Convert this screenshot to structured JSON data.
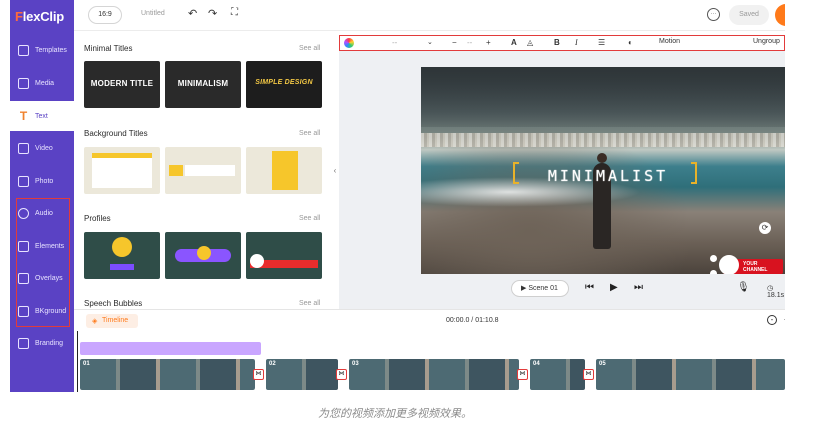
{
  "app": {
    "logo_f": "F",
    "logo_rest": "lexClip"
  },
  "sidebar": {
    "items": [
      {
        "label": "Templates",
        "icon": "layers-icon"
      },
      {
        "label": "Media",
        "icon": "folder-icon"
      },
      {
        "label": "Text",
        "icon": "text-icon",
        "active": true
      },
      {
        "label": "Video",
        "icon": "video-icon"
      },
      {
        "label": "Photo",
        "icon": "photo-icon"
      },
      {
        "label": "Audio",
        "icon": "music-icon"
      },
      {
        "label": "Elements",
        "icon": "elements-icon"
      },
      {
        "label": "Overlays",
        "icon": "overlays-icon"
      },
      {
        "label": "BKground",
        "icon": "background-icon"
      },
      {
        "label": "Branding",
        "icon": "branding-icon"
      }
    ]
  },
  "topbar": {
    "ratio": "16:9",
    "title": "Untitled",
    "saved": "Saved"
  },
  "library": {
    "see_all": "See all",
    "minimal_titles": {
      "heading": "Minimal Titles",
      "tiles": [
        "MODERN TITLE",
        "MINIMALISM",
        "SIMPLE DESIGN"
      ]
    },
    "background_titles": {
      "heading": "Background Titles"
    },
    "profiles": {
      "heading": "Profiles"
    },
    "speech_bubbles": {
      "heading": "Speech Bubbles"
    }
  },
  "text_toolbar": {
    "font_value": "--",
    "size_value": "--",
    "minus": "−",
    "plus": "+",
    "bold": "B",
    "italic": "I",
    "motion": "Motion",
    "ungroup": "Ungroup"
  },
  "preview": {
    "title_text": "MINIMALIST",
    "badge_text": "YOUR CHANNEL"
  },
  "playback": {
    "scene_label": "Scene 01",
    "duration": "18.1s"
  },
  "timeline": {
    "label": "Timeline",
    "time": "00:00.0 / 01:10.8",
    "clips": [
      {
        "num": "01"
      },
      {
        "num": "02"
      },
      {
        "num": "03"
      },
      {
        "num": "04"
      },
      {
        "num": "05"
      }
    ]
  },
  "caption": "为您的视频添加更多视频效果。",
  "colors": {
    "sidebar": "#5a42c4",
    "accent": "#ff7a1a",
    "highlight": "#e23b3b"
  }
}
